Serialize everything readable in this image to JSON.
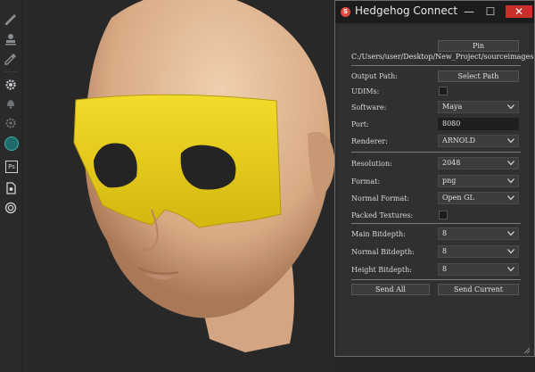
{
  "window": {
    "title": "Hedgehog Connect",
    "minimize": "—",
    "maximize": "☐",
    "close": "✕"
  },
  "pin": {
    "label": "Pin"
  },
  "project_path": "C:/Users/user/Desktop/New_Project/sourceimages",
  "output_path": {
    "label": "Output Path:",
    "button": "Select Path"
  },
  "udims": {
    "label": "UDIMs:"
  },
  "software": {
    "label": "Software:",
    "value": "Maya"
  },
  "port": {
    "label": "Port:",
    "value": "8080"
  },
  "renderer": {
    "label": "Renderer:",
    "value": "ARNOLD"
  },
  "resolution": {
    "label": "Resolution:",
    "value": "2048"
  },
  "format": {
    "label": "Format:",
    "value": "png"
  },
  "normal_format": {
    "label": "Normal Format:",
    "value": "Open GL"
  },
  "packed_textures": {
    "label": "Packed Textures:"
  },
  "main_bitdepth": {
    "label": "Main Bitdepth:",
    "value": "8"
  },
  "normal_bitdepth": {
    "label": "Normal Bitdepth:",
    "value": "8"
  },
  "height_bitdepth": {
    "label": "Height Bitdepth:",
    "value": "8"
  },
  "actions": {
    "send_all": "Send All",
    "send_current": "Send Current"
  },
  "colors": {
    "window_bg": "#2b2b2b",
    "titlebar": "#1c1c1c",
    "close": "#c9302c",
    "mask_yellow": "#e8cf1a",
    "skin": "#e2b896"
  },
  "toolbar_icons": [
    "paint-brush-icon",
    "stamp-icon",
    "eyedropper-icon",
    "gear-icon",
    "bell-icon",
    "settings-icon",
    "substance-icon",
    "photoshop-icon",
    "document-icon",
    "hedgehog-icon"
  ],
  "toolbar_ps_text": "Ps"
}
